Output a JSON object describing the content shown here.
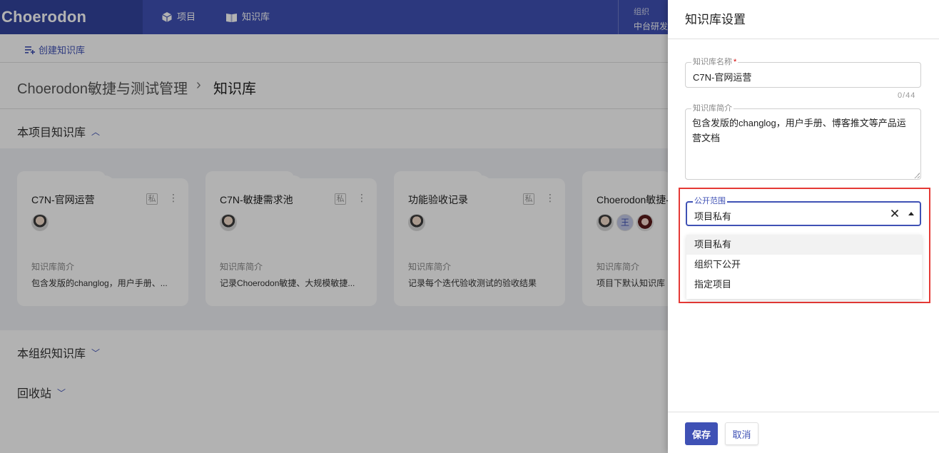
{
  "app": {
    "logo": "Choerodon"
  },
  "nav": {
    "items": [
      {
        "label": "项目",
        "icon": "cube-icon"
      },
      {
        "label": "知识库",
        "icon": "book-icon"
      }
    ]
  },
  "org": {
    "label": "组织",
    "value": "中台研发"
  },
  "toolbar": {
    "create_label": "创建知识库"
  },
  "breadcrumb": {
    "root": "Choerodon敏捷与测试管理",
    "separator": "›",
    "current": "知识库"
  },
  "sections": {
    "project": {
      "title": "本项目知识库"
    },
    "organization": {
      "title": "本组织知识库"
    },
    "recycle": {
      "title": "回收站"
    }
  },
  "cards": [
    {
      "title": "C7N-官网运营",
      "badge": "私",
      "desc_label": "知识库简介",
      "desc": "包含发版的changlog，用户手册、..."
    },
    {
      "title": "C7N-敏捷需求池",
      "badge": "私",
      "desc_label": "知识库简介",
      "desc": "记录Choerodon敏捷、大规模敏捷..."
    },
    {
      "title": "功能验收记录",
      "badge": "私",
      "desc_label": "知识库简介",
      "desc": "记录每个迭代验收测试的验收结果"
    },
    {
      "title": "Choerodon敏捷-",
      "badge": "",
      "avatar_text": "王",
      "desc_label": "知识库简介",
      "desc": "项目下默认知识库"
    }
  ],
  "drawer": {
    "title": "知识库设置",
    "name_field": {
      "label": "知识库名称",
      "value": "C7N-官网运营",
      "counter": "0/44"
    },
    "desc_field": {
      "label": "知识库简介",
      "value": "包含发版的changlog，用户手册、博客推文等产品运营文档"
    },
    "scope_field": {
      "label": "公开范围",
      "value": "项目私有"
    },
    "scope_options": [
      "项目私有",
      "组织下公开",
      "指定项目"
    ],
    "save_label": "保存",
    "cancel_label": "取消"
  },
  "colors": {
    "primary": "#3f51b5",
    "highlight": "#e53935"
  }
}
